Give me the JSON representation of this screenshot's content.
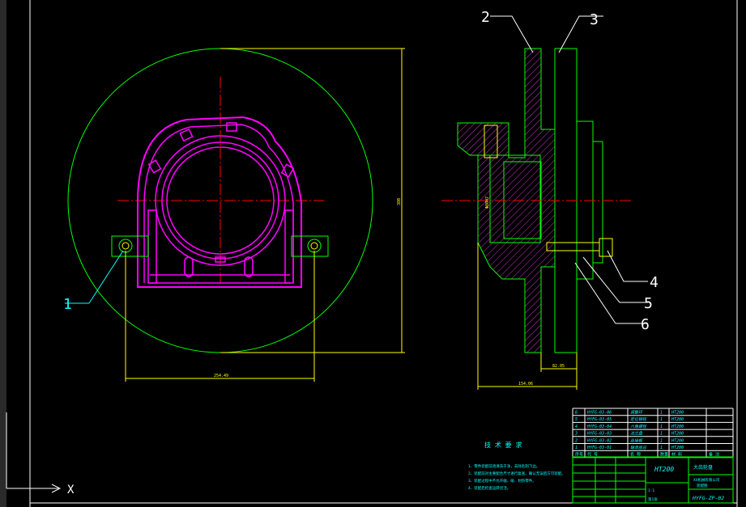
{
  "colors": {
    "background": "#000000",
    "frame": "#ffffff",
    "outline": "#00ff00",
    "part": "#ff00ff",
    "center": "#ff0000",
    "dimension": "#ffff00",
    "hatch": "#cc33cc",
    "text": "#00ffff",
    "leader": "#ffffff"
  },
  "labels": {
    "l1": "1",
    "l2": "2",
    "l3": "3",
    "l4": "4",
    "l5": "5",
    "l6": "6"
  },
  "dimensions": {
    "d_width": "254.49",
    "d_height": "380",
    "d_total": "154.06",
    "d_inner": "82.05",
    "d_bore": "Φ80H7"
  },
  "notes": {
    "title": "技 术 要 求",
    "items": [
      "1、零件装配前须清洗干净，去除毛刺飞边。",
      "2、装配前对主要配合尺寸进行复查，确认无误后方可装配。",
      "3、装配过程中不允许磕、碰、划伤零件。",
      "4、装配后检查运转灵活。"
    ]
  },
  "bom": {
    "rows": [
      {
        "no": "6",
        "code": "HYFG-03-06",
        "name": "调整环",
        "qty": "1",
        "material": "HT200"
      },
      {
        "no": "5",
        "code": "HYFG-03-05",
        "name": "定位销柱",
        "qty": "1",
        "material": "HT200"
      },
      {
        "no": "4",
        "code": "HYFG-03-04",
        "name": "六角螺栓",
        "qty": "1",
        "material": "HT200"
      },
      {
        "no": "3",
        "code": "HYFG-03-03",
        "name": "法兰盘",
        "qty": "1",
        "material": "HT200"
      },
      {
        "no": "2",
        "code": "HYFG-03-02",
        "name": "连接板",
        "qty": "1",
        "material": "HT200"
      },
      {
        "no": "1",
        "code": "HYFG-03-01",
        "name": "轴承座总",
        "qty": "1",
        "material": "HT200"
      }
    ],
    "header": {
      "no": "序号",
      "code": "代 号",
      "name": "名 称",
      "qty": "数量",
      "material": "材 料",
      "remark": "备 注"
    }
  },
  "title_block": {
    "material": "HT200",
    "part_name": "大齿轮盘",
    "company": "XX机械有限公司",
    "dept": "装配图",
    "drawing_no": "HYFG-ZP-02",
    "scale": "1:1",
    "sheet": "第1张"
  },
  "ucs": {
    "x_label": "X"
  }
}
